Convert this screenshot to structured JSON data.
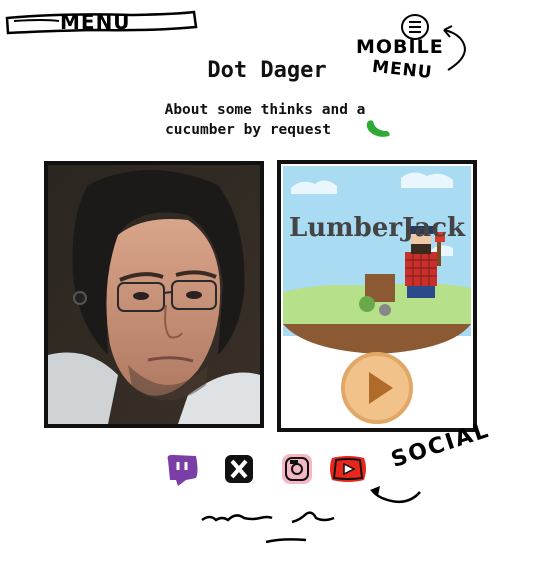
{
  "menu": {
    "label": "MENU"
  },
  "mobile_menu": {
    "label_line1": "MOBILE",
    "label_line2": "MENU",
    "icon": "hamburger-circle-icon"
  },
  "header": {
    "title": "Dot Dager"
  },
  "intro": {
    "line1": "About some thinks and a",
    "line2": "cucumber by request",
    "icon": "cucumber-icon"
  },
  "cards": {
    "portrait": {
      "icon": "portrait-image"
    },
    "game": {
      "title": "LumberJack",
      "play_icon": "play-icon"
    }
  },
  "social": {
    "annotation": "SOCIAL",
    "links": [
      {
        "icon": "twitch-icon",
        "color": "#7a3ea6"
      },
      {
        "icon": "x-icon",
        "color": "#111111"
      },
      {
        "icon": "instagram-icon",
        "color": "#f4b7c4"
      },
      {
        "icon": "youtube-icon",
        "color": "#e8261c"
      }
    ]
  },
  "colors": {
    "background": "#ffffff",
    "ink": "#111111",
    "cucumber": "#2eaa35"
  }
}
